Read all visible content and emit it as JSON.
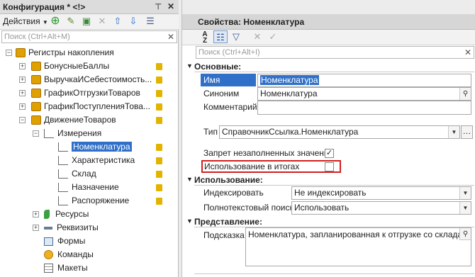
{
  "left_panel": {
    "title": "Конфигурация * <!>",
    "pin_icon": "⊤",
    "close_icon": "✕",
    "actions_label": "Действия",
    "search_placeholder": "Поиск (Ctrl+Alt+M)",
    "search_clear": "✕",
    "tree": {
      "root": "Регистры накопления",
      "items": [
        {
          "label": "БонусныеБаллы"
        },
        {
          "label": "ВыручкаИСебестоимость..."
        },
        {
          "label": "ГрафикОтгрузкиТоваров"
        },
        {
          "label": "ГрафикПоступленияТова..."
        },
        {
          "label": "ДвижениеТоваров"
        }
      ],
      "dimensions_group": "Измерения",
      "dimensions": [
        {
          "label": "Номенклатура"
        },
        {
          "label": "Характеристика"
        },
        {
          "label": "Склад"
        },
        {
          "label": "Назначение"
        },
        {
          "label": "Распоряжение"
        }
      ],
      "resources": "Ресурсы",
      "requisites": "Реквизиты",
      "forms": "Формы",
      "commands": "Команды",
      "layouts": "Макеты"
    }
  },
  "right_panel": {
    "title": "Свойства: Номенклатура",
    "search_placeholder": "Поиск (Ctrl+Alt+I)",
    "search_clear": "✕",
    "sections": {
      "main": "Основные:",
      "usage": "Использование:",
      "presentation": "Представление:"
    },
    "props": {
      "name_label": "Имя",
      "name_value": "Номенклатура",
      "synonym_label": "Синоним",
      "synonym_value": "Номенклатура",
      "comment_label": "Комментарий",
      "comment_value": "",
      "type_label": "Тип",
      "type_value": "СправочникСсылка.Номенклатура",
      "forbid_empty_label": "Запрет незаполненных значений",
      "forbid_empty_checked": true,
      "usage_in_totals_label": "Использование в итогах",
      "usage_in_totals_checked": false,
      "index_label": "Индексировать",
      "index_value": "Не индексировать",
      "fulltext_label": "Полнотекстовый поиск",
      "fulltext_value": "Использовать",
      "tooltip_label": "Подсказка",
      "tooltip_value": "Номенклатура, запланированная к отгрузке со склада."
    },
    "highlight_color": "#d02020"
  }
}
